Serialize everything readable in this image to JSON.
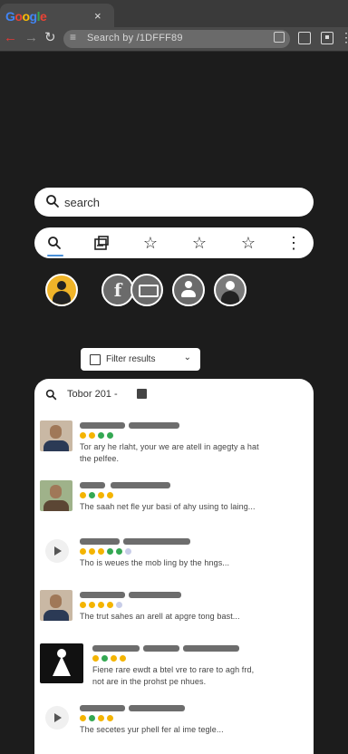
{
  "browser": {
    "tab_title_letters": [
      "G",
      "o",
      "o",
      "g",
      "l",
      "e"
    ],
    "tab_close": "×",
    "omnibox_text": "Search by /1DFFF89",
    "back_icon": "arrow-left",
    "forward_icon": "arrow-right",
    "reload_icon": "reload"
  },
  "search": {
    "placeholder": "search"
  },
  "icon_bar": {
    "items": [
      {
        "name": "search-tab",
        "glyph": "⌕"
      },
      {
        "name": "images-tab",
        "glyph": "▦"
      },
      {
        "name": "favorites-tab",
        "glyph": "☆"
      },
      {
        "name": "starred-tab",
        "glyph": "☆"
      },
      {
        "name": "saved-tab",
        "glyph": "☆"
      },
      {
        "name": "more-tab",
        "glyph": "⋮"
      }
    ]
  },
  "avatars": [
    "person",
    "facebook",
    "bed",
    "user",
    "person"
  ],
  "filter": {
    "label": "Filter results",
    "chevron": "⌄"
  },
  "results": {
    "header": "Tobor 201 -",
    "items": [
      {
        "thumb": "face",
        "stars": [
          "y",
          "y",
          "g",
          "g"
        ],
        "text1": "Tor ary he rlaht, your we are atell in agegty a hat",
        "text2": "the pelfee."
      },
      {
        "thumb": "face2",
        "stars": [
          "y",
          "g",
          "y",
          "y"
        ],
        "text1": "The saah net fle yur basi of ahy using to laing...",
        "text2": ""
      },
      {
        "thumb": "play",
        "stars": [
          "y",
          "y",
          "y",
          "g",
          "g",
          "l"
        ],
        "text1": "Tho is weues the mob ling by the hngs...",
        "text2": ""
      },
      {
        "thumb": "face",
        "stars": [
          "y",
          "y",
          "y",
          "y",
          "l"
        ],
        "text1": "The trut sahes an arell at apgre tong bast...",
        "text2": ""
      },
      {
        "thumb": "dark",
        "stars": [
          "y",
          "g",
          "y",
          "y"
        ],
        "text1": "Fiene rare ewdt a btel vre to rare to agh frd,",
        "text2": "not are in the prohst pe nhues."
      },
      {
        "thumb": "play",
        "stars": [
          "y",
          "g",
          "y",
          "y"
        ],
        "text1": "The secetes yur phell fer al ime tegle...",
        "text2": ""
      }
    ]
  },
  "colors": {
    "page_bg": "#1c1c1c",
    "card_bg": "#ffffff",
    "star_yellow": "#f4b400",
    "star_green": "#34a853",
    "accent": "#4a90d9"
  }
}
